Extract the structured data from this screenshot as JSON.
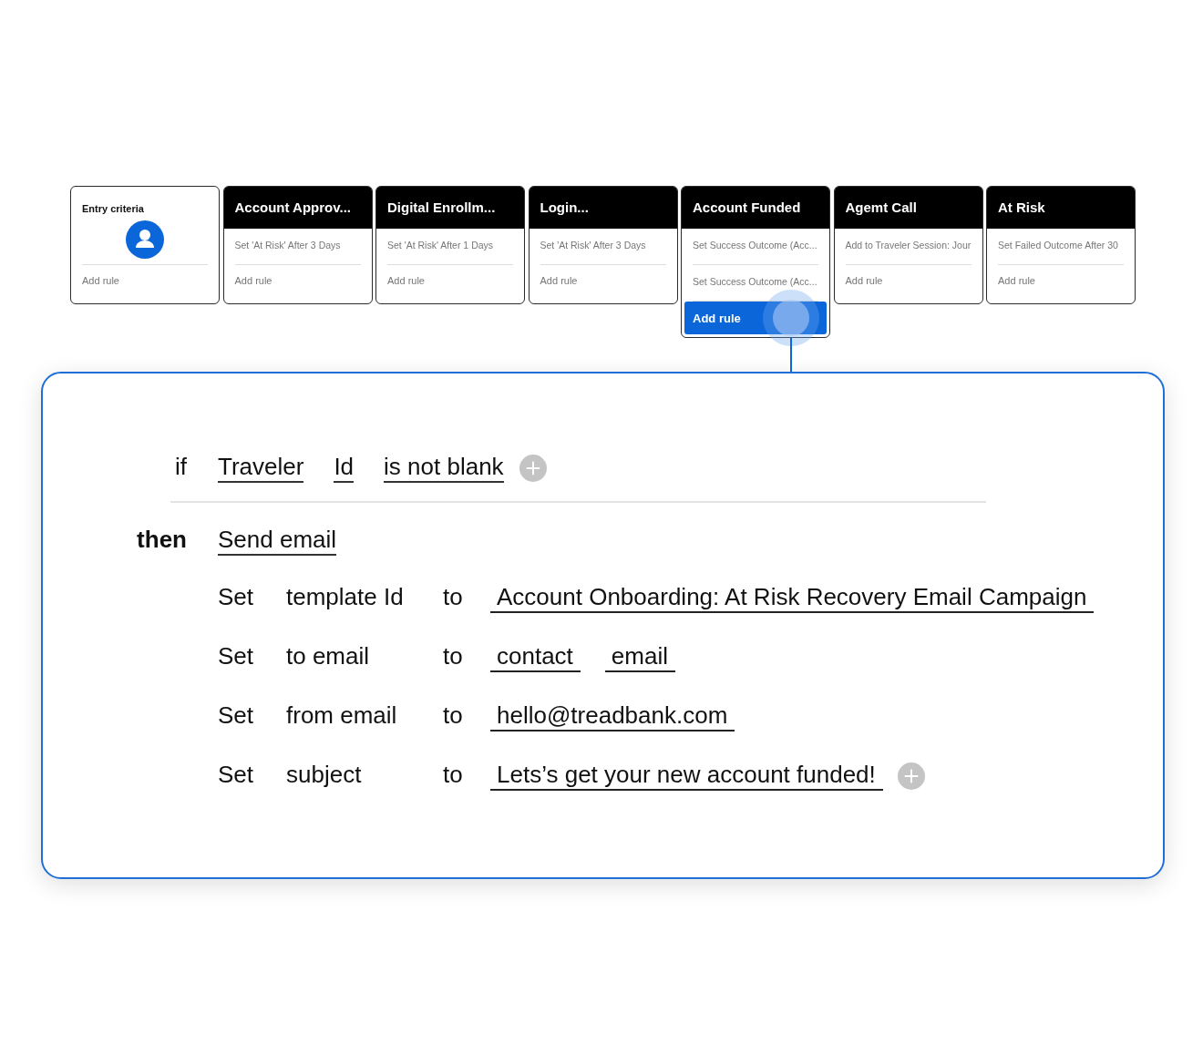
{
  "stages": [
    {
      "kind": "entry",
      "title": "Entry criteria",
      "selected": false,
      "add_rule": "Add rule"
    },
    {
      "kind": "stage",
      "title": "Account Approv...",
      "selected": false,
      "rules": [
        "Set 'At Risk' After 3 Days"
      ],
      "add_rule": "Add rule"
    },
    {
      "kind": "stage",
      "title": "Digital Enrollm...",
      "selected": false,
      "rules": [
        "Set 'At Risk' After 1 Days"
      ],
      "add_rule": "Add rule"
    },
    {
      "kind": "stage",
      "title": "Login...",
      "selected": false,
      "rules": [
        "Set 'At Risk' After 3 Days"
      ],
      "add_rule": "Add rule"
    },
    {
      "kind": "stage",
      "title": "Account Funded",
      "selected": true,
      "rules": [
        "Set Success Outcome (Acc...",
        "Set Success Outcome (Acc..."
      ],
      "add_rule": "Add rule"
    },
    {
      "kind": "stage",
      "title": "Agemt Call",
      "selected": false,
      "rules": [
        "Add to Traveler Session: Jour"
      ],
      "add_rule": "Add rule"
    },
    {
      "kind": "stage",
      "title": "At Risk",
      "selected": false,
      "rules": [
        "Set Failed Outcome After 30"
      ],
      "add_rule": "Add rule"
    }
  ],
  "rule_editor": {
    "condition": {
      "keyword": "if",
      "terms": [
        "Traveler",
        "Id",
        "is not blank"
      ]
    },
    "action": {
      "keyword": "then",
      "name": "Send email",
      "settings": [
        {
          "verb": "Set",
          "field": "template Id",
          "link": "to",
          "values": [
            "Account Onboarding: At Risk Recovery Email Campaign"
          ]
        },
        {
          "verb": "Set",
          "field": "to email",
          "link": "to",
          "values": [
            "contact",
            "email"
          ]
        },
        {
          "verb": "Set",
          "field": "from email",
          "link": "to",
          "values": [
            "hello@treadbank.com"
          ]
        },
        {
          "verb": "Set",
          "field": "subject",
          "link": "to",
          "values": [
            "Lets’s get your new account funded!"
          ]
        }
      ]
    }
  }
}
